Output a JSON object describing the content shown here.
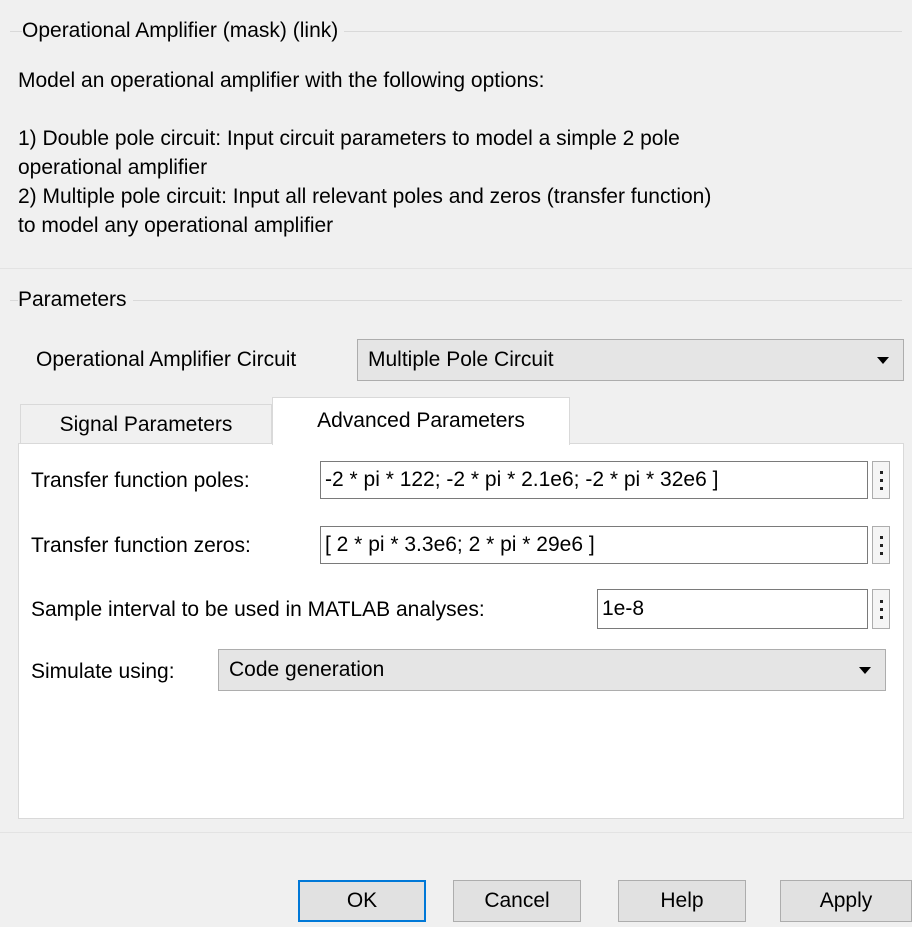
{
  "mask": {
    "title": "Operational Amplifier (mask) (link)",
    "description": "Model an operational amplifier with the following options:\n\n1) Double pole circuit: Input circuit parameters to model a simple 2 pole\noperational amplifier\n2) Multiple pole circuit: Input all relevant poles and zeros (transfer function)\nto model any operational amplifier"
  },
  "parameters": {
    "title": "Parameters",
    "circuit_label": "Operational Amplifier Circuit",
    "circuit_value": "Multiple Pole Circuit"
  },
  "tabs": [
    {
      "label": "Signal Parameters",
      "active": false
    },
    {
      "label": "Advanced Parameters",
      "active": true
    }
  ],
  "fields": {
    "poles_label": "Transfer function poles:",
    "poles_value": "-2 * pi * 122; -2 * pi * 2.1e6; -2 * pi * 32e6 ]",
    "zeros_label": "Transfer function zeros:",
    "zeros_value": "[ 2 * pi * 3.3e6; 2 * pi * 29e6 ]",
    "sample_label": "Sample interval to be used in MATLAB analyses:",
    "sample_value": "1e-8",
    "simulate_label": "Simulate using:",
    "simulate_value": "Code generation"
  },
  "buttons": {
    "ok": "OK",
    "cancel": "Cancel",
    "help": "Help",
    "apply": "Apply"
  },
  "colors": {
    "default_button_border": "#0078d7",
    "background": "#f0f0f0"
  }
}
